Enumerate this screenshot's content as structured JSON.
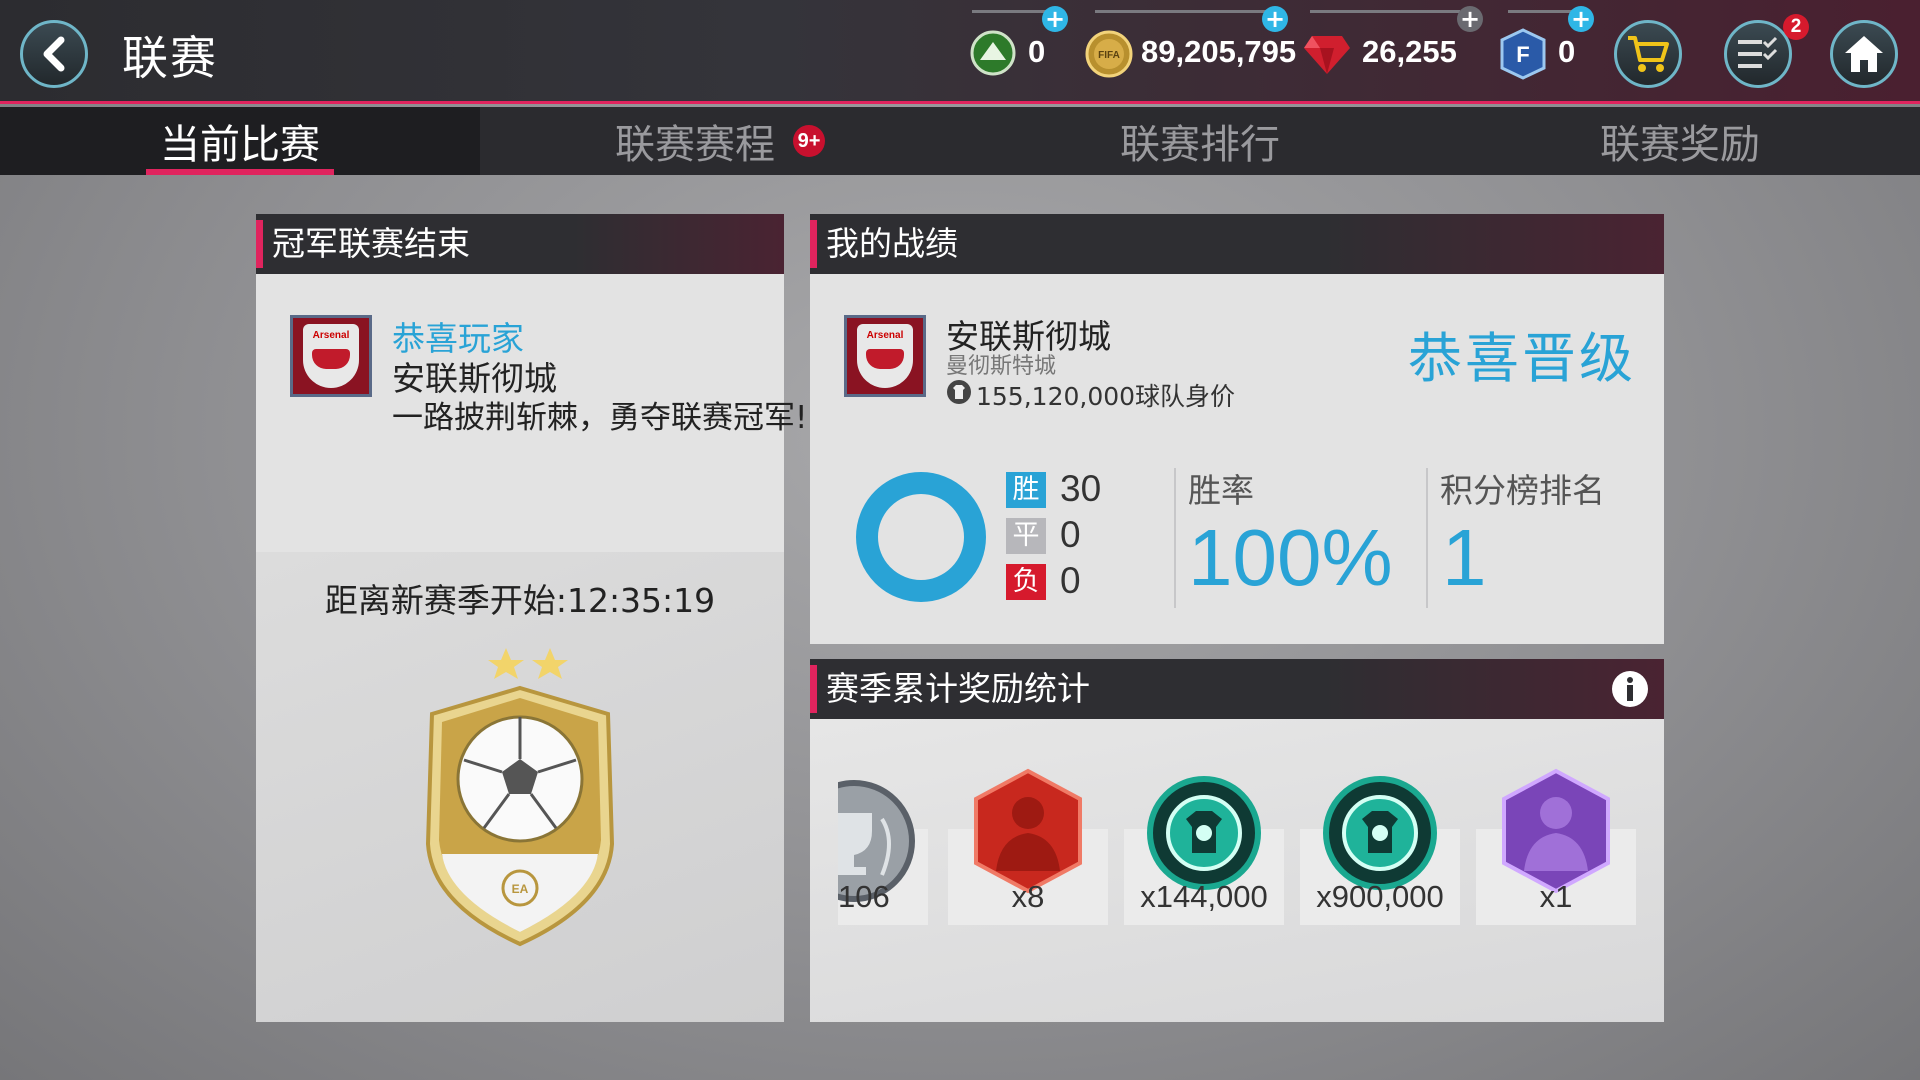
{
  "header": {
    "title": "联赛",
    "currencies": [
      {
        "icon": "grass-icon",
        "value": "0"
      },
      {
        "icon": "fifa-coin-icon",
        "value": "89,205,795"
      },
      {
        "icon": "gem-icon",
        "value": "26,255"
      },
      {
        "icon": "fifa-points-icon",
        "value": "0"
      }
    ],
    "notification_count": "2"
  },
  "tabs": [
    {
      "label": "当前比赛",
      "active": true
    },
    {
      "label": "联赛赛程",
      "badge": "9+"
    },
    {
      "label": "联赛排行"
    },
    {
      "label": "联赛奖励"
    }
  ],
  "champion_panel": {
    "title": "冠军联赛结束",
    "congrats": "恭喜玩家",
    "team_name": "安联斯彻城",
    "message": "一路披荆斩棘，勇夺联赛冠军!",
    "countdown": "距离新赛季开始:12:35:19"
  },
  "record_panel": {
    "title": "我的战绩",
    "team_name": "安联斯彻城",
    "team_subname": "曼彻斯特城",
    "team_value": "155,120,000球队身价",
    "status": "恭喜晋级",
    "win_label": "胜",
    "wins": "30",
    "draw_label": "平",
    "draws": "0",
    "loss_label": "负",
    "losses": "0",
    "win_rate_label": "胜率",
    "win_rate": "100%",
    "rank_label": "积分榜排名",
    "rank": "1",
    "win_color": "#29a3d6"
  },
  "rewards_panel": {
    "title": "赛季累计奖励统计",
    "items": [
      {
        "icon": "trophy-token-icon",
        "count": "106"
      },
      {
        "icon": "red-player-token-icon",
        "count": "x8"
      },
      {
        "icon": "kit-token-icon",
        "count": "x144,000"
      },
      {
        "icon": "kit-token-icon",
        "count": "x900,000"
      },
      {
        "icon": "purple-player-token-icon",
        "count": "x1"
      }
    ]
  },
  "colors": {
    "accent": "#e0245e",
    "highlight": "#29a3d6",
    "loss": "#d61a2d"
  }
}
